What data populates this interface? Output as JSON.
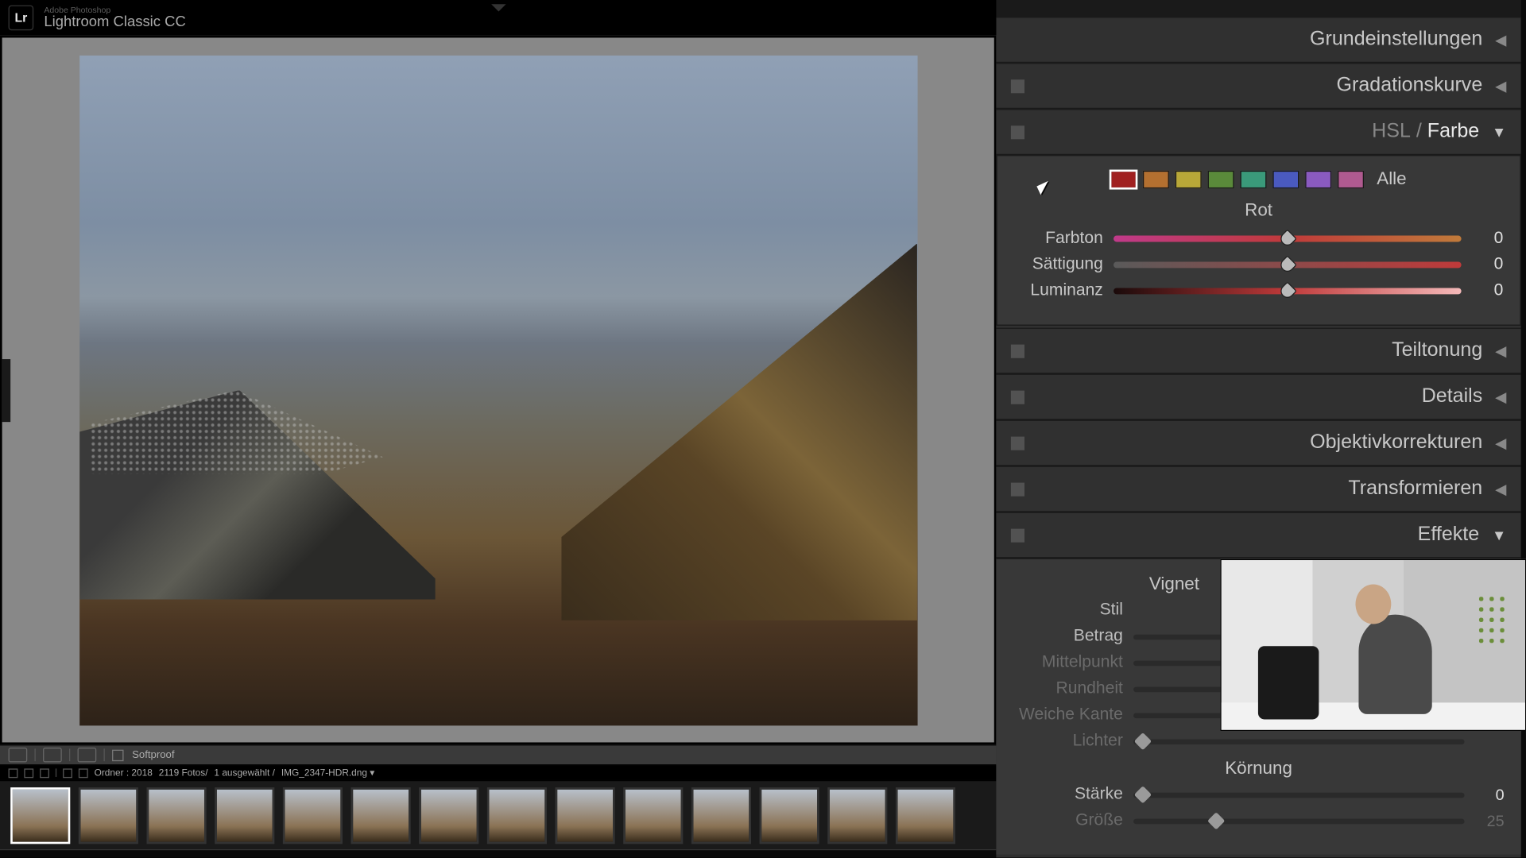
{
  "app": {
    "brand_short": "Lr",
    "brand_sub": "Adobe Photoshop",
    "brand_main": "Lightroom Classic CC"
  },
  "infobar": {
    "softproof": "Softproof"
  },
  "metabar": {
    "folder": "Ordner : 2018",
    "count": "2119 Fotos/",
    "selected": "1 ausgewählt /",
    "filename": "IMG_2347-HDR.dng ▾"
  },
  "panels": {
    "grundeinstellungen": "Grundeinstellungen",
    "gradationskurve": "Gradationskurve",
    "hsl_label": "HSL",
    "farbe_label": "Farbe",
    "teiltonung": "Teiltonung",
    "details": "Details",
    "objektivkorrekturen": "Objektivkorrekturen",
    "transformieren": "Transformieren",
    "effekte": "Effekte"
  },
  "color": {
    "alle": "Alle",
    "selected_name": "Rot",
    "swatches": [
      "#a02020",
      "#b47030",
      "#b8a838",
      "#5a8a3a",
      "#3a9a7a",
      "#4a5ac0",
      "#8a5ac0",
      "#b05a90"
    ],
    "sliders": {
      "farbton": {
        "label": "Farbton",
        "value": "0",
        "grad": "linear-gradient(90deg,#c03a8a,#c03a3a,#c07a3a)"
      },
      "saettigung": {
        "label": "Sättigung",
        "value": "0",
        "grad": "linear-gradient(90deg,#5a5a5a,#c03a3a)"
      },
      "luminanz": {
        "label": "Luminanz",
        "value": "0",
        "grad": "linear-gradient(90deg,#1a0a0a,#c03a3a,#f5baba)"
      }
    }
  },
  "effekte": {
    "vignette_title": "Vignettierung nach Freistellen",
    "vignette_title_short": "Vignet",
    "stil": {
      "label": "Stil"
    },
    "betrag": {
      "label": "Betrag",
      "value": ""
    },
    "mittelpunkt": {
      "label": "Mittelpunkt",
      "value": ""
    },
    "rundheit": {
      "label": "Rundheit",
      "value": ""
    },
    "weiche_kante": {
      "label": "Weiche Kante",
      "value": ""
    },
    "lichter": {
      "label": "Lichter",
      "value": ""
    },
    "koernung_title": "Körnung",
    "staerke": {
      "label": "Stärke",
      "value": "0"
    },
    "groesse": {
      "label": "Größe",
      "value": "25"
    }
  }
}
